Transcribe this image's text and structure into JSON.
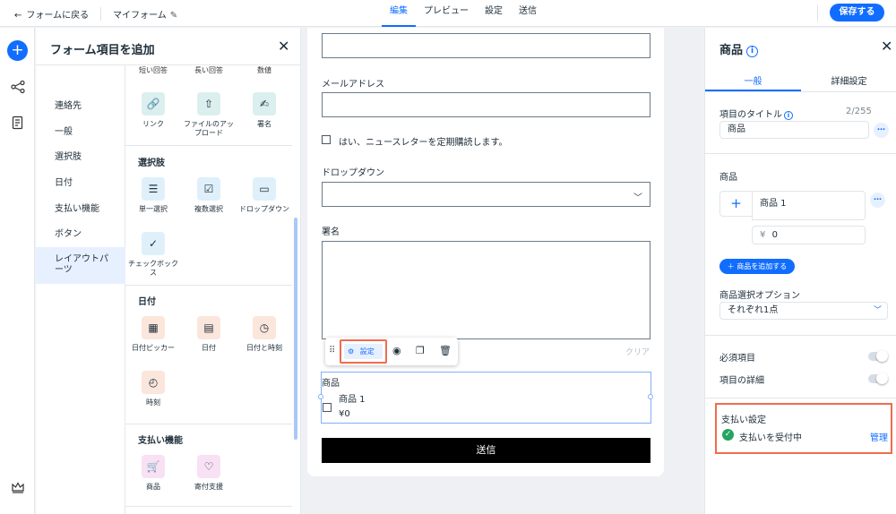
{
  "topbar": {
    "back_label": "フォームに戻る",
    "form_name": "マイフォーム",
    "tabs": [
      {
        "label": "編集"
      },
      {
        "label": "プレビュー"
      },
      {
        "label": "設定"
      },
      {
        "label": "送信"
      }
    ],
    "save_label": "保存する"
  },
  "add_panel": {
    "title": "フォーム項目を追加",
    "categories": [
      {
        "label": "連絡先"
      },
      {
        "label": "一般"
      },
      {
        "label": "選択肢"
      },
      {
        "label": "日付"
      },
      {
        "label": "支払い機能"
      },
      {
        "label": "ボタン"
      },
      {
        "label": "レイアウトパーツ"
      }
    ],
    "top_labels": [
      "短い回答",
      "長い回答",
      "数値"
    ],
    "general_items": [
      {
        "label": "リンク",
        "icon": "link-icon"
      },
      {
        "label": "ファイルのアップロード",
        "icon": "upload-icon"
      },
      {
        "label": "署名",
        "icon": "signature-icon"
      }
    ],
    "choice_section": "選択肢",
    "choice_items": [
      {
        "label": "単一選択",
        "icon": "single-choice-icon"
      },
      {
        "label": "複数選択",
        "icon": "multi-choice-icon"
      },
      {
        "label": "ドロップダウン",
        "icon": "dropdown-icon"
      },
      {
        "label": "チェックボックス",
        "icon": "checkbox-icon"
      }
    ],
    "date_section": "日付",
    "date_items": [
      {
        "label": "日付ピッカー",
        "icon": "date-picker-icon"
      },
      {
        "label": "日付",
        "icon": "calendar-icon"
      },
      {
        "label": "日付と時刻",
        "icon": "date-time-icon"
      },
      {
        "label": "時刻",
        "icon": "clock-icon"
      }
    ],
    "payment_section": "支払い機能",
    "payment_items": [
      {
        "label": "商品",
        "icon": "cart-icon"
      },
      {
        "label": "寄付支援",
        "icon": "donation-icon"
      }
    ]
  },
  "form": {
    "email_label": "メールアドレス",
    "newsletter_label": "はい、ニュースレターを定期購読します。",
    "dropdown_label": "ドロップダウン",
    "signature_label": "署名",
    "clear_label": "クリア",
    "toolbar_settings": "設定",
    "product_label": "商品",
    "product_name": "商品 1",
    "product_price": "¥0",
    "submit_label": "送信"
  },
  "right_panel": {
    "title": "商品",
    "tabs": [
      {
        "label": "一般"
      },
      {
        "label": "詳細設定"
      }
    ],
    "field_title_label": "項目のタイトル",
    "char_count": "2/255",
    "field_title_value": "商品",
    "products_label": "商品",
    "product_name_value": "商品 1",
    "currency": "¥",
    "price_value": "0",
    "add_product_label": "＋ 商品を追加する",
    "selection_label": "商品選択オプション",
    "selection_value": "それぞれ1点",
    "required_label": "必須項目",
    "details_label": "項目の詳細",
    "payment_settings_label": "支払い設定",
    "payment_status": "支払いを受付中",
    "manage_label": "管理"
  },
  "colors": {
    "accent": "#116dff",
    "highlight": "#ef6c4f",
    "success": "#25a55f"
  }
}
